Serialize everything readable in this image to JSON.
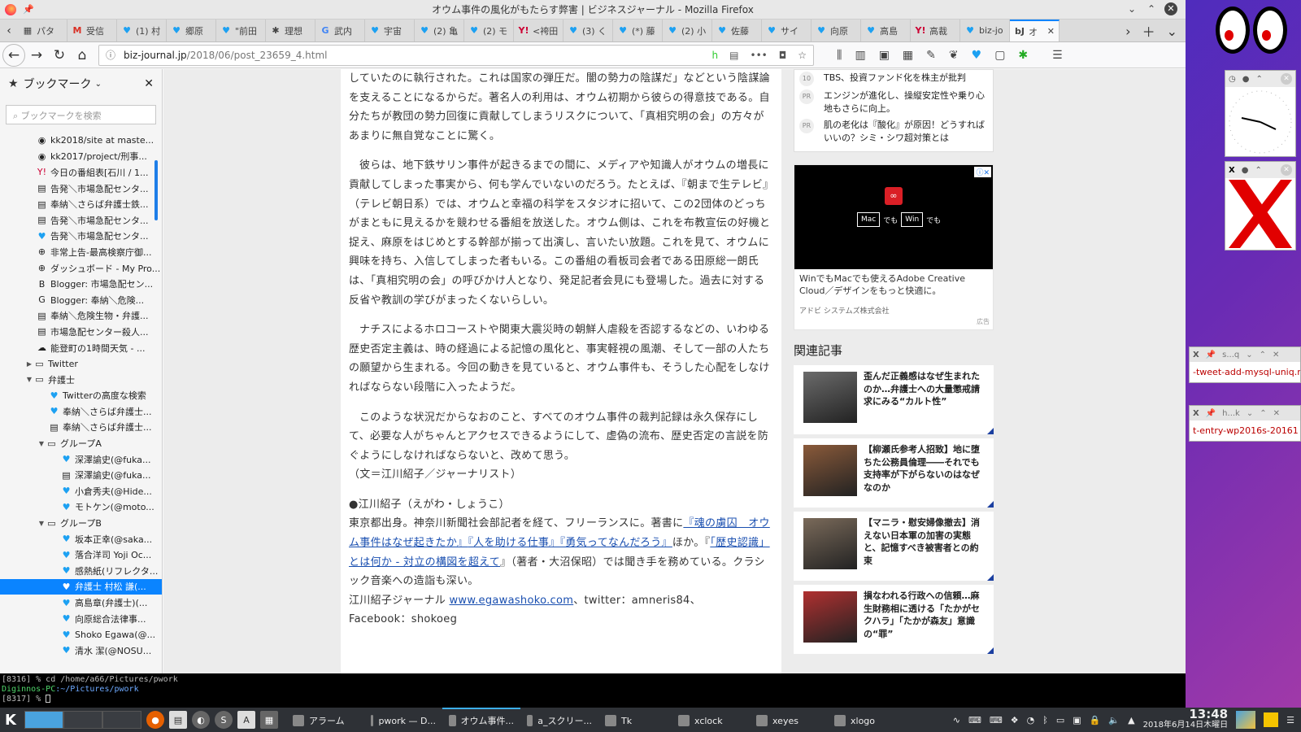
{
  "window": {
    "title": "オウム事件の風化がもたらす弊害 | ビジネスジャーナル - Mozilla Firefox"
  },
  "tabs": [
    {
      "label": "パタ",
      "icon": "grid-icon"
    },
    {
      "label": "受信",
      "icon": "gmail-icon"
    },
    {
      "label": "(1) 村",
      "icon": "twitter-icon"
    },
    {
      "label": "郷原",
      "icon": "twitter-icon"
    },
    {
      "label": "\"前田",
      "icon": "twitter-icon"
    },
    {
      "label": "理想",
      "icon": "star-icon"
    },
    {
      "label": "武内",
      "icon": "google-icon"
    },
    {
      "label": "宇宙",
      "icon": "twitter-icon"
    },
    {
      "label": "(2) 亀",
      "icon": "twitter-icon"
    },
    {
      "label": "(2) モ",
      "icon": "twitter-icon"
    },
    {
      "label": "<袴田",
      "icon": "yahoo-icon"
    },
    {
      "label": "(3) く",
      "icon": "twitter-icon"
    },
    {
      "label": "(*) 藤",
      "icon": "twitter-icon"
    },
    {
      "label": "(2) 小",
      "icon": "twitter-icon"
    },
    {
      "label": "佐藤",
      "icon": "twitter-icon"
    },
    {
      "label": "サイ",
      "icon": "twitter-icon"
    },
    {
      "label": "向原",
      "icon": "twitter-icon"
    },
    {
      "label": "高島",
      "icon": "twitter-icon"
    },
    {
      "label": "高裁",
      "icon": "yahoo-icon"
    },
    {
      "label": "biz-jo",
      "icon": "twitter-icon"
    },
    {
      "label": "オ",
      "icon": "bizjournal-icon",
      "active": true
    }
  ],
  "url": {
    "host": "biz-journal.jp",
    "path": "/2018/06/post_23659_4.html"
  },
  "sidebar": {
    "title": "ブックマーク",
    "search_placeholder": "ブックマークを検索",
    "items": [
      {
        "label": "kk2018/site at maste...",
        "icon": "github-icon",
        "indent": 0
      },
      {
        "label": "kk2017/project/刑事...",
        "icon": "github-icon",
        "indent": 0
      },
      {
        "label": "今日の番組表[石川 / 1...",
        "icon": "yahoo-icon",
        "indent": 0
      },
      {
        "label": "告発＼市場急配センタ...",
        "icon": "page-icon",
        "indent": 0
      },
      {
        "label": "奉納＼さらば弁護士鉄...",
        "icon": "page-icon",
        "indent": 0
      },
      {
        "label": "告発＼市場急配センタ...",
        "icon": "page-icon",
        "indent": 0
      },
      {
        "label": "告発＼市場急配センタ...",
        "icon": "twitter-icon",
        "indent": 0
      },
      {
        "label": "非常上告-最高検察庁御...",
        "icon": "globe-icon",
        "indent": 0
      },
      {
        "label": "ダッシュボード - My Pro...",
        "icon": "globe-icon",
        "indent": 0
      },
      {
        "label": "Blogger: 市場急配セン...",
        "icon": "blogger-icon",
        "indent": 0
      },
      {
        "label": "Blogger: 奉納＼危険...",
        "icon": "google-icon",
        "indent": 0
      },
      {
        "label": "奉納＼危険生物・弁護...",
        "icon": "page-icon",
        "indent": 0
      },
      {
        "label": "市場急配センター殺人...",
        "icon": "page-icon",
        "indent": 0
      },
      {
        "label": "能登町の1時間天気 - ...",
        "icon": "weather-icon",
        "indent": 0
      },
      {
        "label": "Twitter",
        "icon": "folder-icon",
        "indent": 0,
        "folder": "closed"
      },
      {
        "label": "弁護士",
        "icon": "folder-icon",
        "indent": 0,
        "folder": "open"
      },
      {
        "label": "Twitterの高度な検索",
        "icon": "twitter-icon",
        "indent": 1
      },
      {
        "label": "奉納＼さらば弁護士...",
        "icon": "twitter-icon",
        "indent": 1
      },
      {
        "label": "奉納＼さらば弁護士...",
        "icon": "page-icon",
        "indent": 1
      },
      {
        "label": "グループA",
        "icon": "folder-icon",
        "indent": 1,
        "folder": "open"
      },
      {
        "label": "深澤諭史(@fuka...",
        "icon": "twitter-icon",
        "indent": 2
      },
      {
        "label": "深澤諭史(@fuka...",
        "icon": "page-icon",
        "indent": 2
      },
      {
        "label": "小倉秀夫(@Hide...",
        "icon": "twitter-icon",
        "indent": 2
      },
      {
        "label": "モトケン(@moto...",
        "icon": "twitter-icon",
        "indent": 2
      },
      {
        "label": "グループB",
        "icon": "folder-icon",
        "indent": 1,
        "folder": "open"
      },
      {
        "label": "坂本正幸(@saka...",
        "icon": "twitter-icon",
        "indent": 2
      },
      {
        "label": "落合洋司 Yoji Oc...",
        "icon": "twitter-icon",
        "indent": 2
      },
      {
        "label": "感熱紙(リフレクタ...",
        "icon": "twitter-icon",
        "indent": 2
      },
      {
        "label": "弁護士 村松 謙(...",
        "icon": "twitter-icon",
        "indent": 2,
        "selected": true
      },
      {
        "label": "高島章(弁護士)(...",
        "icon": "twitter-icon",
        "indent": 2
      },
      {
        "label": "向原総合法律事...",
        "icon": "twitter-icon",
        "indent": 2
      },
      {
        "label": "Shoko Egawa(@...",
        "icon": "twitter-icon",
        "indent": 2
      },
      {
        "label": "清水 潔(@NOSU...",
        "icon": "twitter-icon",
        "indent": 2
      }
    ]
  },
  "article": {
    "p1": "していたのに執行された。これは国家の弾圧だ。闇の勢力の陰謀だ」などという陰謀論を支えることになるからだ。著名人の利用は、オウム初期から彼らの得意技である。自分たちが教団の勢力回復に貢献してしまうリスクについて、「真相究明の会」の方々があまりに無自覚なことに驚く。",
    "p2": "彼らは、地下鉄サリン事件が起きるまでの間に、メディアや知識人がオウムの増長に貢献してしまった事実から、何も学んでいないのだろう。たとえば、『朝まで生テレビ』（テレビ朝日系）では、オウムと幸福の科学をスタジオに招いて、この2団体のどっちがまともに見えるかを競わせる番組を放送した。オウム側は、これを布教宣伝の好機と捉え、麻原をはじめとする幹部が揃って出演し、言いたい放題。これを見て、オウムに興味を持ち、入信してしまった者もいる。この番組の看板司会者である田原総一朗氏は、「真相究明の会」の呼びかけ人となり、発足記者会見にも登場した。過去に対する反省や教訓の学びがまったくないらしい。",
    "p3": "ナチスによるホロコーストや関東大震災時の朝鮮人虐殺を否認するなどの、いわゆる歴史否定主義は、時の経過による記憶の風化と、事実軽視の風潮、そして一部の人たちの願望から生まれる。今回の動きを見ていると、オウム事件も、そうした心配をしなければならない段階に入ったようだ。",
    "p4": "このような状況だからなおのこと、すべてのオウム事件の裁判記録は永久保存にして、必要な人がちゃんとアクセスできるようにして、虚偽の流布、歴史否定の言説を防ぐようにしなければならないと、改めて思う。",
    "byline": "（文＝江川紹子／ジャーナリスト）",
    "author_head": "●江川紹子（えがわ・しょうこ）",
    "bio_1": "東京都出身。神奈川新聞社会部記者を経て、フリーランスに。著書に",
    "book1": "『魂の虜囚　オウム事件はなぜ起きたか』",
    "book2": "『人を助ける仕事』",
    "book3": "『勇気ってなんだろう』",
    "bio_2": "ほか。『",
    "book4": "「歴史認識」とは何か - 対立の構図を超えて",
    "bio_3": "』（著者・大沼保昭）では聞き手を務めている。クラシック音楽への造詣も深い。",
    "site_prefix": "江川紹子ジャーナル ",
    "site_link": "www.egawashoko.com",
    "site_suffix": "、twitter：amneris84、",
    "facebook": "Facebook：shokoeg"
  },
  "ranking": [
    {
      "num": "10",
      "text": "TBS、投資ファンド化を株主が批判"
    },
    {
      "num": "PR",
      "text": "エンジンが進化し、操縦安定性や乗り心地もさらに向上。"
    },
    {
      "num": "PR",
      "text": "肌の老化は『酸化』が原因！どうすればいいの？シミ・シワ超対策とは"
    }
  ],
  "ad": {
    "badge_mac": "Mac",
    "badge_win": "Win",
    "de": "でも",
    "text": "WinでもMacでも使えるAdobe Creative Cloud／デザインをもっと快適に。",
    "company": "アドビ システムズ株式会社",
    "label": "広告"
  },
  "related": {
    "title": "関連記事",
    "items": [
      {
        "text": "歪んだ正義感はなぜ生まれたのか…弁護士への大量懲戒請求にみる“カルト性”",
        "thumb": "#6b6b6b"
      },
      {
        "text": "【柳瀬氏参考人招致】地に堕ちた公務員倫理――それでも支持率が下がらないのはなぜなのか",
        "thumb": "#8a5a3a"
      },
      {
        "text": "【マニラ・慰安婦像撤去】消えない日本軍の加害の実態と、記憶すべき被害者との約束",
        "thumb": "#7a6a5a"
      },
      {
        "text": "損なわれる行政への信頼…麻生財務相に透ける「たかがセクハラ」「たかが森友」意識の“罪”",
        "thumb": "#b03030"
      }
    ]
  },
  "terminal": {
    "line1": "[8316]  %  cd /home/a66/Pictures/pwork",
    "host": "Diginnos-PC",
    "path": ":~/Pictures/pwork",
    "line3": "[8317]  % "
  },
  "notes": [
    {
      "bar": "s...q",
      "text": "-tweet-add-mysql-uniq.r"
    },
    {
      "bar": "h...k",
      "text": "t-entry-wp2016s-20161"
    }
  ],
  "taskbar": {
    "tasks": [
      {
        "label": "アラーム",
        "icon": "alarm-icon"
      },
      {
        "label": "pwork — D...",
        "icon": "folder-icon"
      },
      {
        "label": "オウム事件...",
        "icon": "firefox-icon",
        "active": true
      },
      {
        "label": "a_スクリー...",
        "icon": "terminal-icon"
      },
      {
        "label": "Tk",
        "icon": "tk-icon"
      },
      {
        "label": "xclock",
        "icon": "clock-icon"
      },
      {
        "label": "xeyes",
        "icon": "eyes-icon"
      },
      {
        "label": "xlogo",
        "icon": "x-icon"
      }
    ],
    "time": "13:48",
    "date": "2018年6月14日木曜日"
  },
  "colors": {
    "accent": "#0a84ff",
    "twitter": "#1da1f2",
    "link": "#1a4fb0",
    "related_corner": "#1b3fa0"
  }
}
